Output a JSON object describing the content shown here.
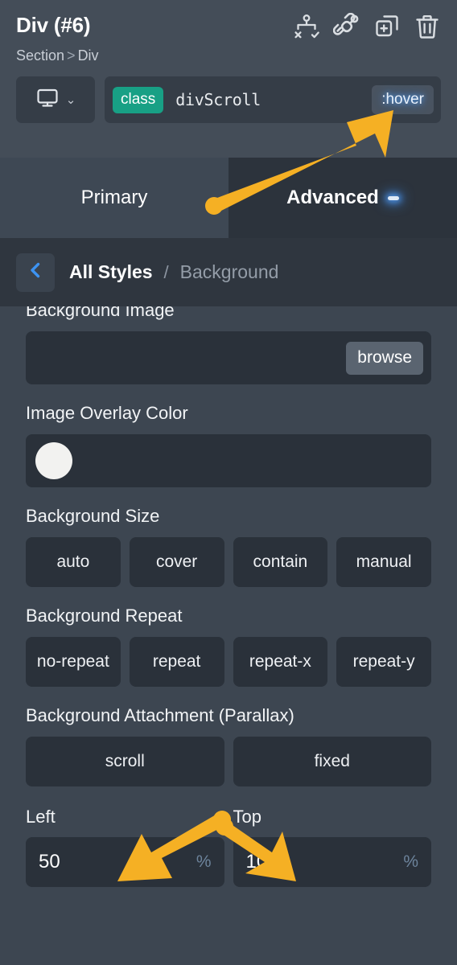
{
  "header": {
    "element_title": "Div (#6)",
    "breadcrumb": {
      "parent": "Section",
      "separator": ">",
      "current": "Div"
    },
    "icons": [
      {
        "name": "sitemap-toggle-icon",
        "label": "sitemap"
      },
      {
        "name": "unlink-icon",
        "label": "unlink"
      },
      {
        "name": "duplicate-icon",
        "label": "duplicate"
      },
      {
        "name": "trash-icon",
        "label": "delete"
      }
    ],
    "device_selector": {
      "icon": "desktop-icon",
      "chevron": "⌄"
    },
    "selector": {
      "type_label": "class",
      "selector_name": "divScroll",
      "state": ":hover"
    }
  },
  "tabs": [
    {
      "label": "Primary",
      "active": false,
      "badge": false
    },
    {
      "label": "Advanced",
      "active": true,
      "badge": true
    }
  ],
  "sub_breadcrumb": {
    "back_icon": "chevron-left-icon",
    "root": "All Styles",
    "separator": "/",
    "section": "Background"
  },
  "fields": {
    "background_image": {
      "label": "Background Image",
      "value": "",
      "browse_label": "browse"
    },
    "image_overlay_color": {
      "label": "Image Overlay Color",
      "swatch_color": "#f2f2f0"
    },
    "background_size": {
      "label": "Background Size",
      "options": [
        "auto",
        "cover",
        "contain",
        "manual"
      ]
    },
    "background_repeat": {
      "label": "Background Repeat",
      "options": [
        "no-repeat",
        "repeat",
        "repeat-x",
        "repeat-y"
      ]
    },
    "background_attachment": {
      "label": "Background Attachment (Parallax)",
      "options": [
        "scroll",
        "fixed"
      ]
    },
    "position": {
      "left": {
        "label": "Left",
        "value": "50",
        "unit": "%"
      },
      "top": {
        "label": "Top",
        "value": "100",
        "unit": "%"
      }
    }
  },
  "annotations": {
    "arrow_color": "#f5b024",
    "arrows": [
      {
        "name": "arrow-to-hover-state",
        "target": ":hover"
      },
      {
        "name": "arrow-to-left-field",
        "target": "Left"
      },
      {
        "name": "arrow-to-top-field",
        "target": "Top"
      }
    ]
  },
  "colors": {
    "header_bg": "#444d58",
    "tab_inactive_bg": "#3e4854",
    "tab_active_bg": "#2c333c",
    "subbar_bg": "#2f363f",
    "body_bg": "#3d4651",
    "input_bg": "#2a313a",
    "class_pill": "#18a085",
    "accent_blue": "#4d93e6",
    "unit_text": "#6d849c",
    "browse_btn": "#5a6470"
  }
}
